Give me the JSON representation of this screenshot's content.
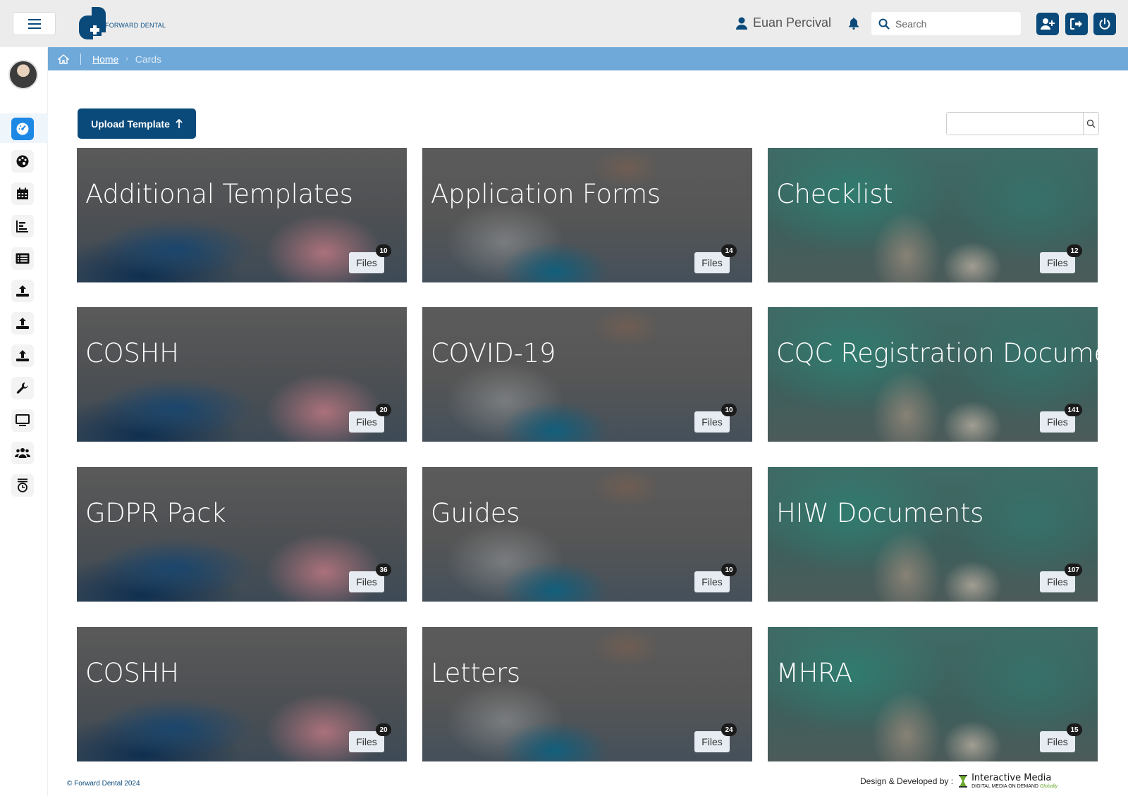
{
  "brand": {
    "logo_text": "FORWARD DENTAL",
    "primary_color": "#0a4a7a",
    "breadcrumb_color": "#6fa9d9"
  },
  "header": {
    "user_name": "Euan Percival",
    "search_placeholder": "Search"
  },
  "breadcrumb": {
    "home_label": "Home",
    "current": "Cards"
  },
  "toolbar": {
    "upload_label": "Upload Template"
  },
  "sidebar": {
    "items": [
      {
        "icon": "dashboard-icon",
        "active": true
      },
      {
        "icon": "palette-icon"
      },
      {
        "icon": "calendar-icon"
      },
      {
        "icon": "chart-icon"
      },
      {
        "icon": "list-icon"
      },
      {
        "icon": "upload-icon"
      },
      {
        "icon": "upload-icon"
      },
      {
        "icon": "upload-icon"
      },
      {
        "icon": "wrench-icon"
      },
      {
        "icon": "monitor-icon"
      },
      {
        "icon": "users-icon"
      },
      {
        "icon": "timer-icon"
      }
    ]
  },
  "cards": [
    {
      "title": "Additional Templates",
      "files_label": "Files",
      "count": "10"
    },
    {
      "title": "Application Forms",
      "files_label": "Files",
      "count": "14"
    },
    {
      "title": "Checklist",
      "files_label": "Files",
      "count": "12"
    },
    {
      "title": "COSHH",
      "files_label": "Files",
      "count": "20"
    },
    {
      "title": "COVID-19",
      "files_label": "Files",
      "count": "10"
    },
    {
      "title": "CQC Registration Documents",
      "files_label": "Files",
      "count": "141"
    },
    {
      "title": "GDPR Pack",
      "files_label": "Files",
      "count": "36"
    },
    {
      "title": "Guides",
      "files_label": "Files",
      "count": "10"
    },
    {
      "title": "HIW Documents",
      "files_label": "Files",
      "count": "107"
    },
    {
      "title": "COSHH",
      "files_label": "Files",
      "count": "20"
    },
    {
      "title": "Letters",
      "files_label": "Files",
      "count": "24"
    },
    {
      "title": "MHRA",
      "files_label": "Files",
      "count": "15"
    }
  ],
  "footer": {
    "copyright": "© Forward Dental 2024",
    "developed_by": "Design & Developed by :",
    "company": "Interactive Media",
    "tagline": "DIGITAL MEDIA ON DEMAND",
    "tagline_accent": "Globally"
  }
}
